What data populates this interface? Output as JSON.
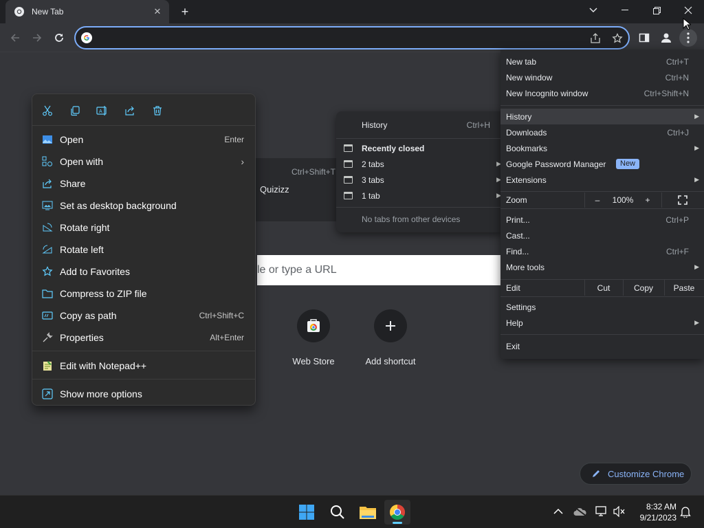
{
  "browser": {
    "tab": {
      "title": "New Tab",
      "close": "✕"
    },
    "new_tab_symbol": "+",
    "omnibox": {
      "value": ""
    }
  },
  "ntp": {
    "search_fragment": "le or type a URL",
    "shortcuts": [
      {
        "label": "Web Store",
        "icon": "web-store-icon"
      },
      {
        "label": "Add shortcut",
        "icon": "plus-icon"
      }
    ],
    "customize_label": "Customize Chrome"
  },
  "context_menu": {
    "top_icons": [
      "cut-icon",
      "copy-icon",
      "rename-icon",
      "share-icon",
      "delete-icon"
    ],
    "items": [
      {
        "label": "Open",
        "shortcut": "Enter",
        "icon": "photo-icon"
      },
      {
        "label": "Open with",
        "shortcut": "",
        "icon": "open-with-icon",
        "submenu": true
      },
      {
        "label": "Share",
        "shortcut": "",
        "icon": "share-icon"
      },
      {
        "label": "Set as desktop background",
        "shortcut": "",
        "icon": "desktop-background-icon"
      },
      {
        "label": "Rotate right",
        "shortcut": "",
        "icon": "rotate-right-icon"
      },
      {
        "label": "Rotate left",
        "shortcut": "",
        "icon": "rotate-left-icon"
      },
      {
        "label": "Add to Favorites",
        "shortcut": "",
        "icon": "star-icon"
      },
      {
        "label": "Compress to ZIP file",
        "shortcut": "",
        "icon": "zip-icon"
      },
      {
        "label": "Copy as path",
        "shortcut": "Ctrl+Shift+C",
        "icon": "copy-path-icon"
      },
      {
        "label": "Properties",
        "shortcut": "Alt+Enter",
        "icon": "wrench-icon"
      },
      {
        "label": "Edit with Notepad++",
        "shortcut": "",
        "icon": "notepad-plus-icon"
      },
      {
        "label": "Show more options",
        "shortcut": "",
        "icon": "more-options-icon"
      }
    ]
  },
  "background_fragment": {
    "shortcut": "Ctrl+Shift+T",
    "site": "Quizizz"
  },
  "history_submenu": {
    "history_label": "History",
    "history_shortcut": "Ctrl+H",
    "recently_closed": "Recently closed",
    "entries": [
      "2 tabs",
      "3 tabs",
      "1 tab"
    ],
    "other_devices": "No tabs from other devices"
  },
  "chrome_menu": {
    "new_tab": "New tab",
    "new_tab_sc": "Ctrl+T",
    "new_window": "New window",
    "new_window_sc": "Ctrl+N",
    "incognito": "New Incognito window",
    "incognito_sc": "Ctrl+Shift+N",
    "history": "History",
    "downloads": "Downloads",
    "downloads_sc": "Ctrl+J",
    "bookmarks": "Bookmarks",
    "password_manager": "Google Password Manager",
    "new_badge": "New",
    "extensions": "Extensions",
    "zoom": "Zoom",
    "zoom_minus": "–",
    "zoom_value": "100%",
    "zoom_plus": "+",
    "print": "Print...",
    "print_sc": "Ctrl+P",
    "cast": "Cast...",
    "find": "Find...",
    "find_sc": "Ctrl+F",
    "more_tools": "More tools",
    "edit": "Edit",
    "cut": "Cut",
    "copy": "Copy",
    "paste": "Paste",
    "settings": "Settings",
    "help": "Help",
    "exit": "Exit"
  },
  "taskbar": {
    "time": "8:32 AM",
    "date": "9/21/2023"
  }
}
